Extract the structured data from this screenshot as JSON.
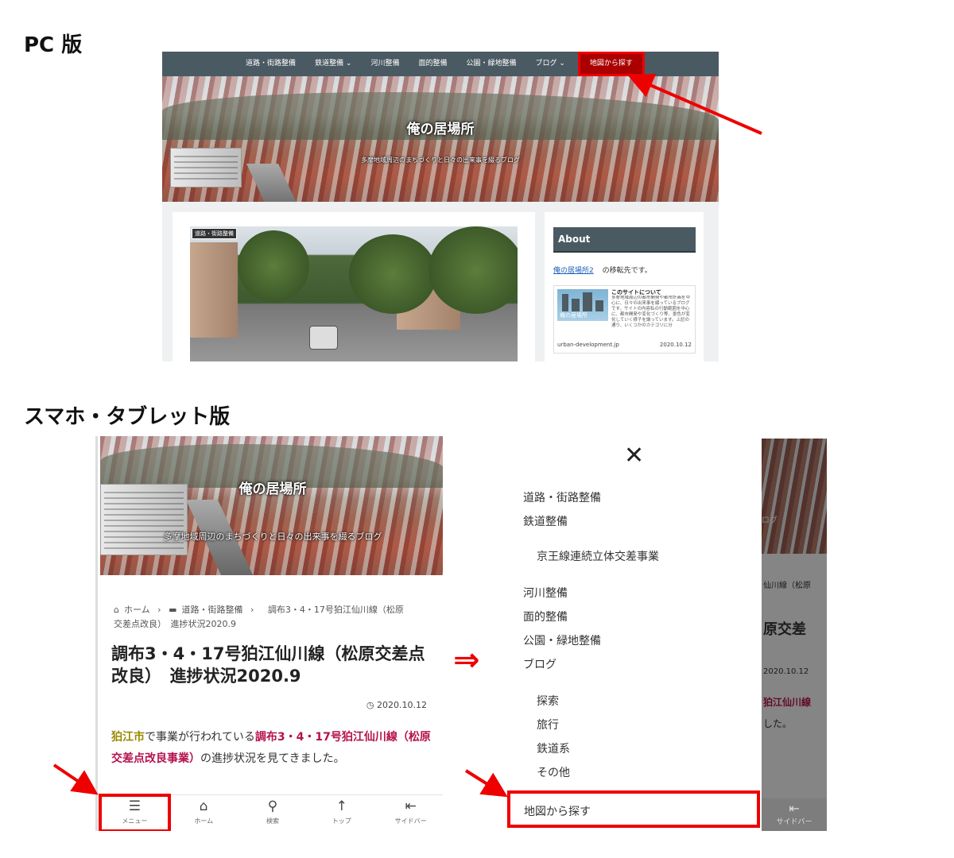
{
  "labels": {
    "pc": "PC 版",
    "mobile": "スマホ・タブレット版"
  },
  "colors": {
    "nav": "#4a5a62",
    "highlight": "#e00000"
  },
  "site": {
    "title": "俺の居場所",
    "tagline_pc": "多摩地域周辺のまちづくりと日々の出来事を綴るブログ",
    "tagline_mobile": "多摩地域周辺のまちづくりと日々の出来事を綴るブログ"
  },
  "pc": {
    "nav": [
      "道路・街路整備",
      "鉄道整備 ⌄",
      "河川整備",
      "面的整備",
      "公園・緑地整備",
      "ブログ ⌄",
      "地図から探す"
    ],
    "category_badge": "道路・街路整備",
    "about": {
      "heading": "About",
      "link": "俺の居場所2",
      "moved_text": "の移転先です。",
      "card_title": "このサイトについて",
      "card_desc": "多摩地域周辺の都市開発や都市計画を中心に、日々の出来事を綴っているブログです。サイトの内容私の行動範囲を中心に、都市開発や変化づくり等、景色が変化していく様子を論っています。上記の通り、いくつかのカテゴリに分",
      "card_logo": "俺の居場所",
      "card_domain": "urban-development.jp",
      "card_date": "2020.10.12"
    }
  },
  "mobile": {
    "breadcrumb": {
      "home": "ホーム",
      "sep": "›",
      "category": "道路・街路整備",
      "current_line1": "調布3・4・17号狛江仙川線（松原",
      "current_line2": "交差点改良）　進捗状況2020.9"
    },
    "post_title": "調布3・4・17号狛江仙川線（松原交差点改良）　進捗状況2020.9",
    "post_date": "2020.10.12",
    "excerpt": {
      "city": "狛江市",
      "mid": "で事業が行われている",
      "project": "調布3・4・17号狛江仙川線（松原交差点改良事業）",
      "end": "の進捗状況を見てきました。"
    },
    "tabs": [
      {
        "icon": "☰",
        "label": "メニュー"
      },
      {
        "icon": "⌂",
        "label": "ホーム"
      },
      {
        "icon": "⚲",
        "label": "検索"
      },
      {
        "icon": "↑",
        "label": "トップ"
      },
      {
        "icon": "⇤",
        "label": "サイドバー"
      }
    ]
  },
  "drawer": {
    "close": "✕",
    "items": [
      "道路・街路整備",
      "鉄道整備",
      "京王線連続立体交差事業",
      "河川整備",
      "面的整備",
      "公園・緑地整備",
      "ブログ",
      "探索",
      "旅行",
      "鉄道系",
      "その他"
    ],
    "map_item": "地図から探す",
    "bg_hero_text": "ログ",
    "bg_text_1": "仙川線（松原",
    "bg_text_2": "原交差",
    "bg_text_3": "2020.10.12",
    "bg_text_4": "狛江仙川線",
    "bg_text_5": "した。",
    "bg_tab_icon": "⇤",
    "bg_tab_label": "サイドバー"
  },
  "arrow_symbol": "⇒"
}
